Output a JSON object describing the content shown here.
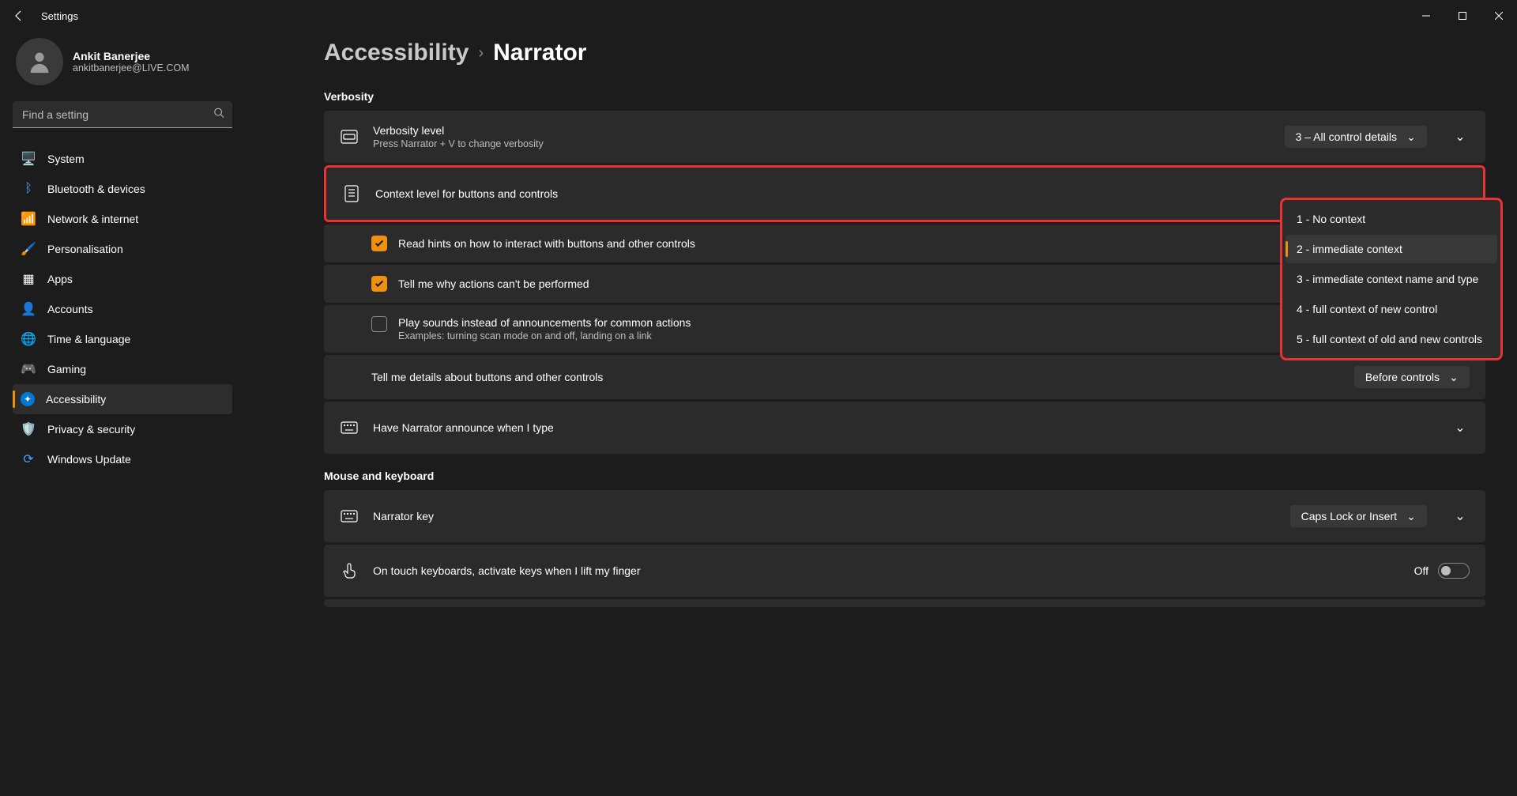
{
  "titlebar": {
    "title": "Settings"
  },
  "user": {
    "name": "Ankit Banerjee",
    "email": "ankitbanerjee@LIVE.COM"
  },
  "search": {
    "placeholder": "Find a setting"
  },
  "nav": [
    {
      "label": "System"
    },
    {
      "label": "Bluetooth & devices"
    },
    {
      "label": "Network & internet"
    },
    {
      "label": "Personalisation"
    },
    {
      "label": "Apps"
    },
    {
      "label": "Accounts"
    },
    {
      "label": "Time & language"
    },
    {
      "label": "Gaming"
    },
    {
      "label": "Accessibility"
    },
    {
      "label": "Privacy & security"
    },
    {
      "label": "Windows Update"
    }
  ],
  "breadcrumb": {
    "parent": "Accessibility",
    "current": "Narrator"
  },
  "sections": {
    "verbosity": {
      "title": "Verbosity",
      "level": {
        "title": "Verbosity level",
        "sub": "Press Narrator + V to change verbosity",
        "value": "3 – All control details"
      },
      "context": {
        "title": "Context level for buttons and controls"
      },
      "context_options": [
        "1 - No context",
        "2 - immediate context",
        "3 - immediate context name and type",
        "4 - full context of new control",
        "5 - full context of old and new controls"
      ],
      "hints": {
        "label": "Read hints on how to interact with buttons and other controls"
      },
      "whynot": {
        "label": "Tell me why actions can't be performed"
      },
      "sounds": {
        "label": "Play sounds instead of announcements for common actions",
        "sub": "Examples: turning scan mode on and off, landing on a link"
      },
      "details": {
        "label": "Tell me details about buttons and other controls",
        "value": "Before controls"
      },
      "announce": {
        "title": "Have Narrator announce when I type"
      }
    },
    "mouse": {
      "title": "Mouse and keyboard",
      "narrator_key": {
        "title": "Narrator key",
        "value": "Caps Lock or Insert"
      },
      "touch": {
        "title": "On touch keyboards, activate keys when I lift my finger",
        "value": "Off"
      }
    }
  }
}
